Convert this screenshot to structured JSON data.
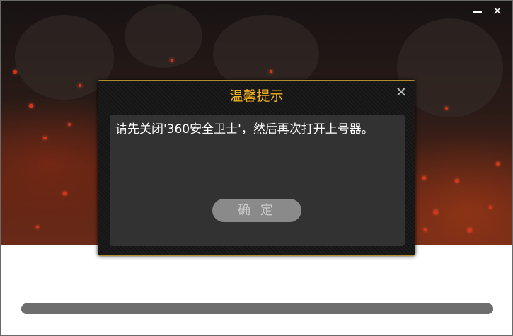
{
  "window": {
    "minimize_label": "",
    "close_label": "✕"
  },
  "dialog": {
    "title": "温馨提示",
    "close_label": "✕",
    "message": "请先关闭'360安全卫士'，然后再次打开上号器。",
    "ok_label": "确 定"
  },
  "progress": {
    "value": 1.0
  },
  "colors": {
    "title": "#f2b21e",
    "dialog_border": "#b18a2b",
    "button": "#8a8a8a",
    "progress": "#6e6e6e"
  },
  "icons": {
    "minimize": "minimize-icon",
    "close": "close-icon",
    "dialog_close": "close-icon"
  }
}
